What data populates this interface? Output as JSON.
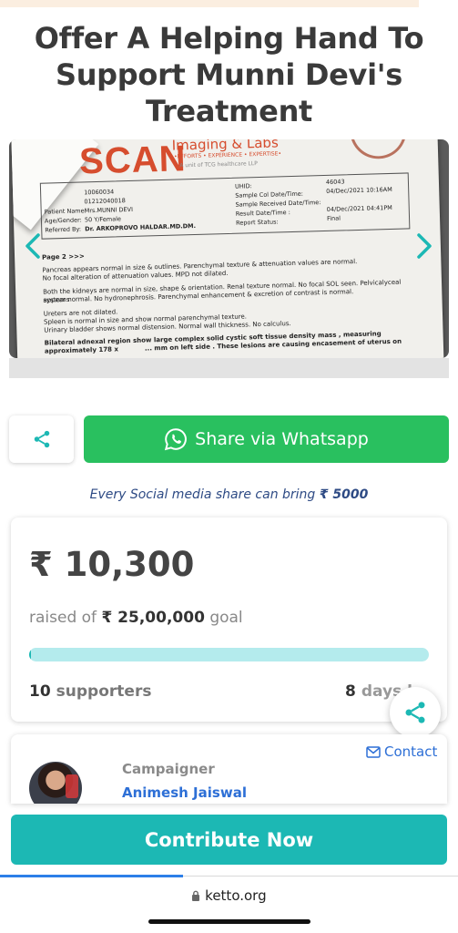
{
  "campaign": {
    "title": "Offer A Helping Hand To Support Munni Devi's Treatment"
  },
  "share": {
    "whatsapp_label": "Share via Whatsapp",
    "social_note_prefix": "Every Social media share can bring",
    "social_note_amount": "₹ 5000"
  },
  "stats": {
    "raised": "₹ 10,300",
    "raised_of_prefix": "raised of",
    "goal": "₹ 25,00,000",
    "goal_suffix": "goal",
    "progress_fraction": 0.004,
    "supporters_count": "10",
    "supporters_label": "supporters",
    "days_count": "8",
    "days_label": "days left"
  },
  "campaigner": {
    "contact_label": "Contact",
    "role_label": "Campaigner",
    "name": "Animesh Jaiswal"
  },
  "cta": {
    "contribute_label": "Contribute Now"
  },
  "browser": {
    "url": "ketto.org"
  },
  "report_image": {
    "logo": "SCAN",
    "logo_sub": "Imaging & Labs",
    "logo_tagline": "•EFFORTS • EXPERIENCE • EXPERTISE•",
    "logo_unit": "A unit of TCG healthcare LLP",
    "patient_id": "10060034",
    "reg_no": "01212040018",
    "patient_name_label": "Patient Name:",
    "patient_name": "Mrs.MUNNI DEVI",
    "gender_label": "Age/Gender:",
    "gender": "50 Y/Female",
    "referred_label": "Referred By:",
    "referred_by": "Dr. ARKOPROVO HALDAR.MD.DM.",
    "uhid_label": "UHID:",
    "uhid": "46043",
    "col_label": "Sample Col Date/Time:",
    "col_date": "04/Dec/2021 10:16AM",
    "recv_label": "Sample Received Date/Time:",
    "result_label": "Result Date/Time :",
    "result_date": "04/Dec/2021 04:41PM",
    "status_label": "Report Status:",
    "status": "Final",
    "page": "Page 2 >>>",
    "line1": "Pancreas appears normal in size & outlines. Parenchymal texture & attenuation values are normal.",
    "line2": "No focal alteration of attenuation values. MPD not dilated.",
    "line3": "Both the kidneys are normal in size, shape & orientation. Renal texture normal. No focal SOL seen. Pelvicalyceal systems",
    "line4": "appear normal. No hydronephrosis. Parenchymal enhancement & excretion of contrast is normal.",
    "line5": "Ureters are not dilated.",
    "line6": "Spleen is normal in size and show normal parenchymal texture.",
    "line7": "Urinary bladder shows normal distension. Normal wall thickness. No calculus.",
    "line8": "Bilateral adnexal region show large complex solid cystic soft tissue density mass , measuring approximately 178 x",
    "line9": "... mm on left side . These lesions are causing encasement of uterus on"
  },
  "colors": {
    "whatsapp": "#29c05f",
    "primary": "#1cb8b4",
    "link": "#2d6fd6",
    "note": "#2d4a84"
  }
}
